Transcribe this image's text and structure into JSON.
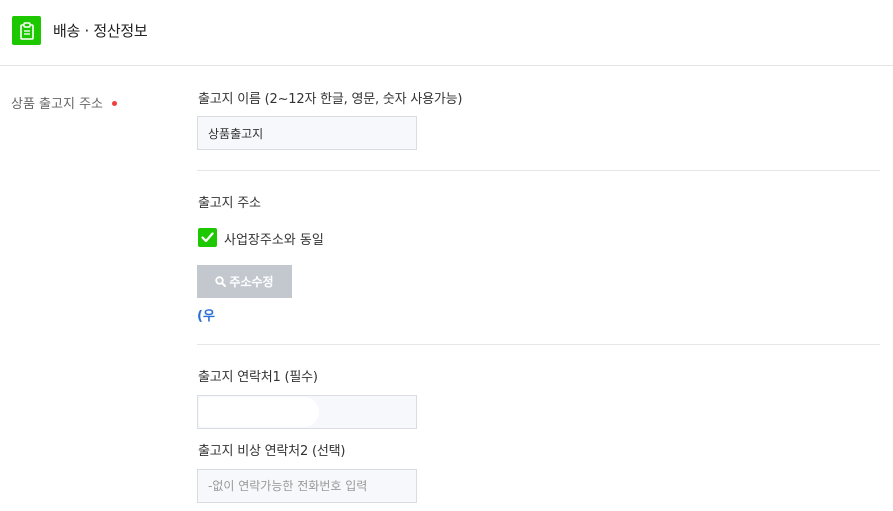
{
  "header": {
    "title": "배송 · 정산정보",
    "icon": "clipboard-icon",
    "icon_color": "#1ec800"
  },
  "row": {
    "label": "상품 출고지 주소",
    "required_color": "#f03e3e"
  },
  "warehouse_name": {
    "label": "출고지 이름 (2~12자 한글, 영문, 숫자 사용가능)",
    "value": "상품출고지"
  },
  "warehouse_address": {
    "label": "출고지 주소",
    "same_as_business_label": "사업장주소와 동일",
    "same_as_business_checked": true,
    "edit_button_label": "주소수정",
    "edit_button_icon": "search-icon",
    "postcode_text": "(우"
  },
  "contact1": {
    "label": "출고지 연락처1 (필수)",
    "value": ""
  },
  "contact2": {
    "label": "출고지 비상 연락처2 (선택)",
    "placeholder": "-없이 연락가능한 전화번호 입력"
  },
  "colors": {
    "accent": "#1ec800",
    "button_disabled": "#c3c8cf",
    "link": "#2a6fd6"
  }
}
